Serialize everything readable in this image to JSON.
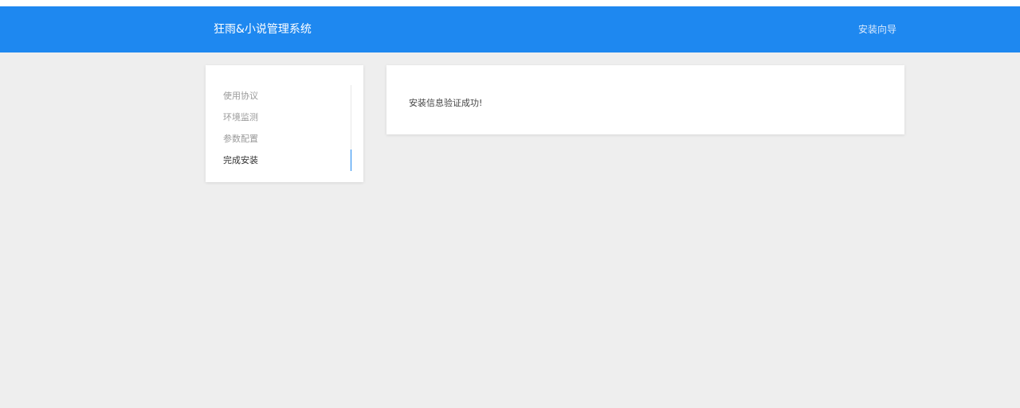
{
  "header": {
    "title": "狂雨&小说管理系统",
    "nav_link": "安装向导"
  },
  "sidebar": {
    "steps": [
      {
        "label": "使用协议",
        "active": false
      },
      {
        "label": "环境监测",
        "active": false
      },
      {
        "label": "参数配置",
        "active": false
      },
      {
        "label": "完成安装",
        "active": true
      }
    ]
  },
  "content": {
    "message": "安装信息验证成功!"
  },
  "colors": {
    "header_bg": "#1e88f0",
    "page_bg": "#eeeeee",
    "active_step_bar": "#1e88f0"
  }
}
